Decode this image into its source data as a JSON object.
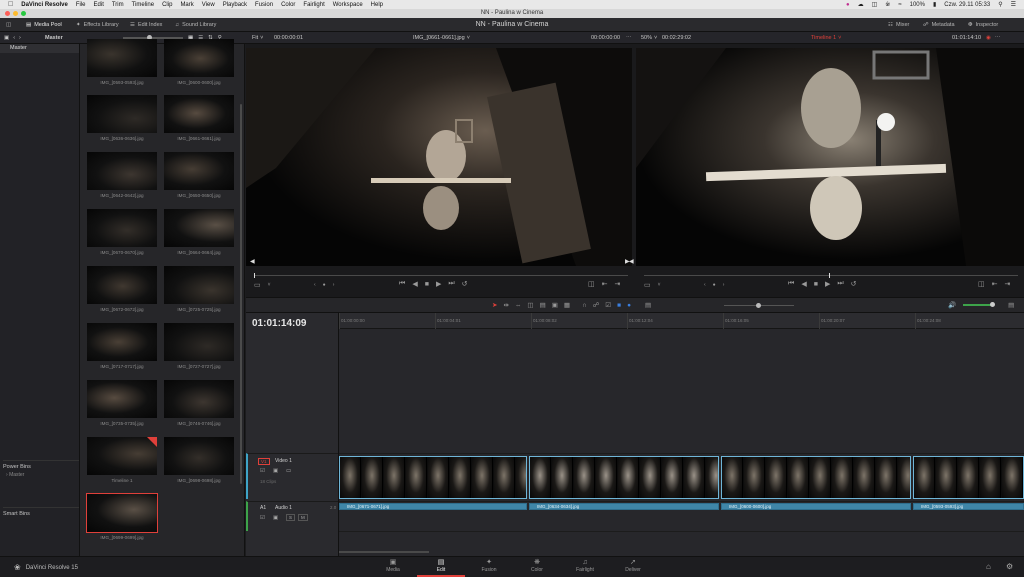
{
  "mac_menu": {
    "app": "DaVinci Resolve",
    "items": [
      "File",
      "Edit",
      "Trim",
      "Timeline",
      "Clip",
      "Mark",
      "View",
      "Playback",
      "Fusion",
      "Color",
      "Fairlight",
      "Workspace",
      "Help"
    ],
    "status_battery": "100%",
    "status_clock": "Czw. 29.11  05:33"
  },
  "window_title": "NN - Paulina w Cinema",
  "toolbar": {
    "media_pool": "Media Pool",
    "effects_library": "Effects Library",
    "edit_index": "Edit Index",
    "sound_library": "Sound Library",
    "project_title": "NN - Paulina w Cinema",
    "mixer": "Mixer",
    "metadata": "Metadata",
    "inspector": "Inspector"
  },
  "bar2": {
    "bin_label": "Master",
    "fit": "Fit",
    "source_timecode": "00:00:00:01",
    "source_clip": "IMG_[0661-0661].jpg",
    "source_duration": "00:00:00:00",
    "zoom": "50%",
    "timeline_duration": "00:02:29:02",
    "timeline_name": "Timeline 1",
    "timeline_timecode": "01:01:14:10"
  },
  "bins": {
    "master": "Master",
    "power_bins": "Power Bins",
    "power_master": "Master",
    "smart_bins": "Smart Bins"
  },
  "clips": [
    "IMG_[0593-0593].jpg",
    "IMG_[0600-0600].jpg",
    "IMG_[0636-0636].jpg",
    "IMG_[0661-0661].jpg",
    "IMG_[0642-0642].jpg",
    "IMG_[0650-0650].jpg",
    "IMG_[0670-0670].jpg",
    "IMG_[0664-0664].jpg",
    "IMG_[0672-0672].jpg",
    "IMG_[0725-0725].jpg",
    "IMG_[0717-0717].jpg",
    "IMG_[0727-0727].jpg",
    "IMG_[0735-0735].jpg",
    "IMG_[0746-0746].jpg",
    "Timeline 1",
    "IMG_[0698-0698].jpg",
    "IMG_[0699-0699].jpg"
  ],
  "timeline": {
    "timecode": "01:01:14:09",
    "ruler": [
      "01:00:00:00",
      "01:00:04:01",
      "01:00:08:02",
      "01:00:12:04",
      "01:00:16:05",
      "01:00:20:07",
      "01:00:24:08"
    ],
    "v1_tag": "V1",
    "v1_name": "Video 1",
    "v1_clips_count": "18 Clips",
    "a1_tag": "A1",
    "a1_name": "Audio 1",
    "a1_level": "2.0",
    "audio_clips": [
      "IMG_[0671-0671].jpg",
      "IMG_[0634-0634].jpg",
      "IMG_[0600-0600].jpg",
      "IMG_[0593-0593].jpg"
    ]
  },
  "pages": {
    "brand": "DaVinci Resolve 15",
    "items": [
      "Media",
      "Edit",
      "Fusion",
      "Color",
      "Fairlight",
      "Deliver"
    ],
    "active": "Edit"
  },
  "colors": {
    "accent_red": "#e0403a",
    "clip_blue": "#3f86a8",
    "clip_border": "#6fb6d8"
  }
}
